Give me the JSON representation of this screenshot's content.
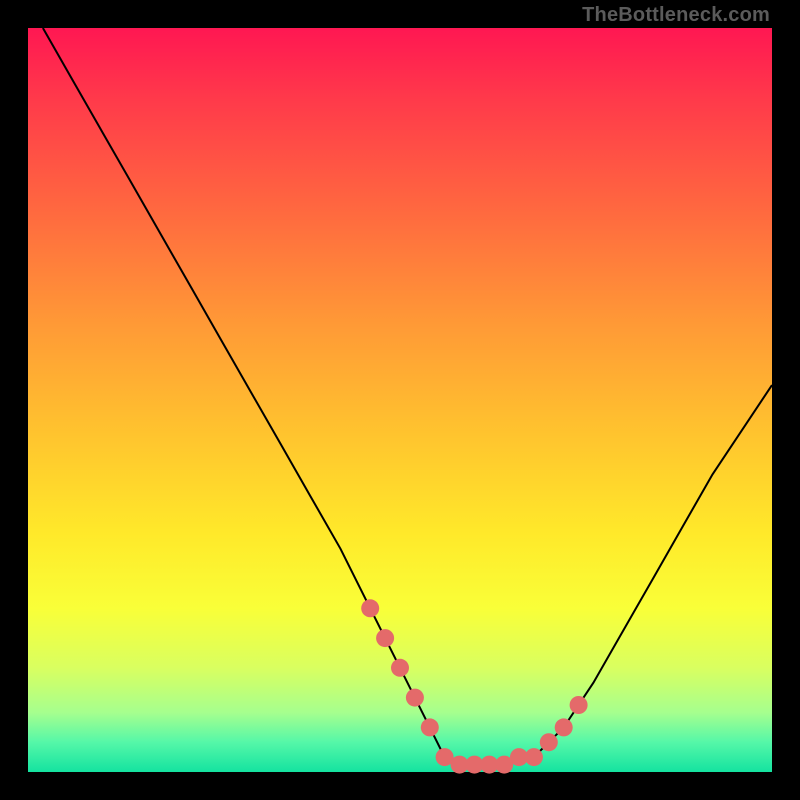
{
  "attribution": "TheBottleneck.com",
  "colors": {
    "frame": "#000000",
    "gradient_top": "#ff1752",
    "gradient_bottom": "#14e3a0",
    "curve": "#000000",
    "marker": "#e46a6a"
  },
  "chart_data": {
    "type": "line",
    "title": "",
    "xlabel": "",
    "ylabel": "",
    "xlim": [
      0,
      100
    ],
    "ylim": [
      0,
      100
    ],
    "series": [
      {
        "name": "bottleneck-curve",
        "x": [
          2,
          6,
          10,
          14,
          18,
          22,
          26,
          30,
          34,
          38,
          42,
          46,
          50,
          54,
          56,
          58,
          60,
          64,
          68,
          72,
          76,
          80,
          84,
          88,
          92,
          96,
          100
        ],
        "y": [
          100,
          93,
          86,
          79,
          72,
          65,
          58,
          51,
          44,
          37,
          30,
          22,
          14,
          6,
          2,
          1,
          1,
          1,
          2,
          6,
          12,
          19,
          26,
          33,
          40,
          46,
          52
        ]
      }
    ],
    "markers": {
      "name": "highlight-band",
      "x": [
        46,
        48,
        50,
        52,
        54,
        56,
        58,
        60,
        62,
        64,
        66,
        68,
        70,
        72,
        74
      ],
      "y": [
        22,
        18,
        14,
        10,
        6,
        2,
        1,
        1,
        1,
        1,
        2,
        2,
        4,
        6,
        9
      ],
      "r": 9
    }
  }
}
